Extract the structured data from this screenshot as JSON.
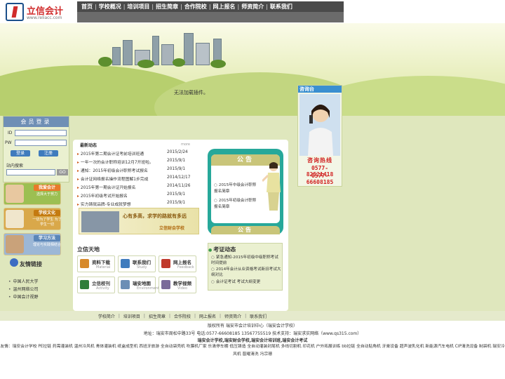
{
  "brand": {
    "name": "立信会计",
    "url": "www.reliacc.com"
  },
  "nav": [
    "首页",
    "学校概况",
    "培训项目",
    "招生简章",
    "合作院校",
    "网上报名",
    "师资简介",
    "联系我们"
  ],
  "plugin_message": "无法加载插件。",
  "login": {
    "title": "会员登录",
    "id_label": "ID",
    "pw_label": "PW",
    "login_btn": "登录",
    "register_btn": "注册",
    "search_label": "站内搜索",
    "search_btn": "GO"
  },
  "side_boxes": [
    {
      "tag": "我爱会计",
      "sub": "选择大于努力"
    },
    {
      "tag": "学校文化",
      "sub": "一切为了学生 为了学生一切"
    },
    {
      "tag": "学习方法",
      "sub": "理论与实践相结合"
    }
  ],
  "friends": {
    "title": "友情链接",
    "items": [
      "中国人民大学",
      "温州网络公司",
      "中国会计视野"
    ]
  },
  "news": {
    "title": "最新动态",
    "more": "more",
    "items": [
      {
        "title": "2015年第二期会计证考前培训班通",
        "date": "2015/2/24"
      },
      {
        "title": "一年一次的会计职称培训12月7开班啦。",
        "date": "2015/9/1"
      },
      {
        "title": "通知：2015年初级会计职称考试报名",
        "date": "2015/9/1"
      },
      {
        "title": "会计证网络报名操作流程图解1步完成",
        "date": "2014/12/17"
      },
      {
        "title": "2015年第一期会计证开始报名",
        "date": "2014/11/26"
      },
      {
        "title": "2015年初级考试开始报名",
        "date": "2015/9/1"
      },
      {
        "title": "实力铸就品牌-专业成就梦想",
        "date": "2015/9/1"
      }
    ]
  },
  "motto": {
    "text": "心有多高，求学的路就有多远",
    "sub": "立信财会学校"
  },
  "notice": {
    "title": "公告",
    "bottom_title": "公告",
    "items": [
      "2015年中级会计职称报名简章",
      "2015年初级会计职称报名简章"
    ]
  },
  "tiles": {
    "title": "立信天地",
    "items": [
      {
        "cn": "资料下载",
        "en": "Material",
        "color": "#d7892a"
      },
      {
        "cn": "联系我们",
        "en": "Study",
        "color": "#3f7bbd"
      },
      {
        "cn": "网上报名",
        "en": "Feedback",
        "color": "#c0392b"
      },
      {
        "cn": "立信校刊",
        "en": "Activity",
        "color": "#2e7d3a"
      },
      {
        "cn": "瑞安地图",
        "en": "Environment",
        "color": "#6c8fb5"
      },
      {
        "cn": "教学视频",
        "en": "Video",
        "color": "#7a6a99"
      }
    ]
  },
  "exam": {
    "title": "考证动态",
    "items": [
      "紧急通知-2015年初级中级职称考试时间提前",
      "2014年会计从业资格考试新旧考试大纲对比",
      "会计证考试 考试大纲变更"
    ]
  },
  "consult": {
    "title": "咨询台",
    "hotline": "咨询热线",
    "tels": [
      "0577-82521418",
      "0577-66608185"
    ]
  },
  "footer": {
    "nav": [
      "学校简介",
      "培训项目",
      "招生简章",
      "合作院校",
      "网上报名",
      "师资简介",
      "联系我们"
    ],
    "copyright": "版权所有  瑞安市会计培训中心（瑞安会计学校）",
    "address": "地址：瑞安市周松中路33号  电话:0577-66608185  13567755519 技术支持：瑞安求实网络（www.qs315.com）",
    "keywords": "瑞安会计学校,瑞安财会学校,瑞安会计培训班,瑞安会计考试",
    "friend_links": "友情：瑞安会计学校 PE拉链 药需灌装机 温州冷风机 青体灌装机 纸盒成型机 西班牙旅游 全自动袋壳机 吹膜机厂家 乐清停车棚 低压铸造 全自动灌装封尾机 多线切割机 印花机 户外拓展训练 bb拉链 全自动贴角机 牙膏设备 超声波乳化机 新能源汽车电机 CIP清洗设备 制袋机 瑞安冷风机 晋耀清洗 冯宗珊"
  }
}
